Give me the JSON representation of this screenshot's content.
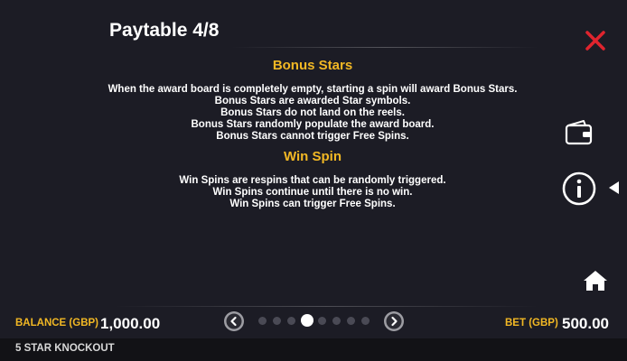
{
  "header": {
    "title": "Paytable 4/8"
  },
  "sections": [
    {
      "heading": "Bonus Stars",
      "lines": [
        "When the award board is completely empty, starting a spin will award Bonus Stars.",
        "Bonus Stars are awarded Star symbols.",
        "Bonus Stars do not land on the reels.",
        "Bonus Stars randomly populate the award board.",
        "Bonus Stars cannot trigger Free Spins."
      ]
    },
    {
      "heading": "Win Spin",
      "lines": [
        "Win Spins are respins that can be randomly triggered.",
        "Win Spins continue until there is no win.",
        "Win Spins can trigger Free Spins."
      ]
    }
  ],
  "icons": {
    "close": "close-icon",
    "wallet": "wallet-icon",
    "info": "info-icon",
    "home": "home-icon"
  },
  "pagination": {
    "total": 8,
    "current": 4
  },
  "bottom_bar": {
    "balance_label": "BALANCE (GBP)",
    "balance_value": "1,000.00",
    "bet_label": "BET (GBP)",
    "bet_value": "500.00"
  },
  "footer": {
    "game_name": "5 STAR KNOCKOUT"
  },
  "colors": {
    "background": "#1c1c25",
    "accent_gold": "#f2b824",
    "close_red": "#e0242e",
    "footer_bg": "#121216"
  }
}
